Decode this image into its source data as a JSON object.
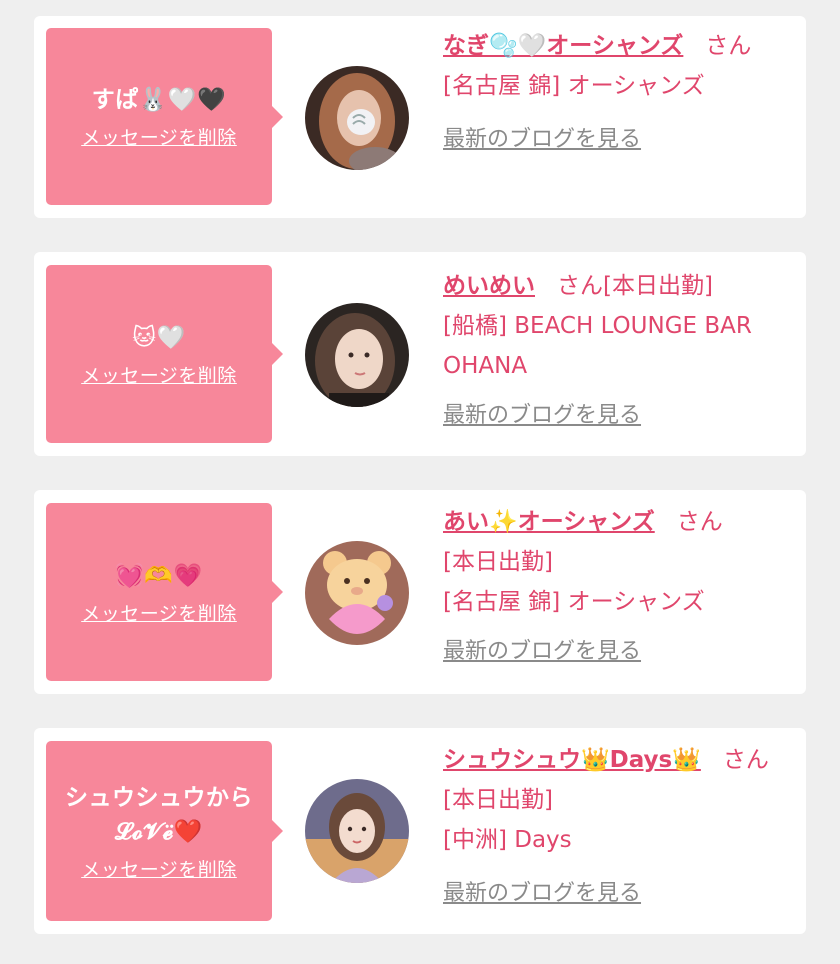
{
  "cards": [
    {
      "message": "すぱ🐰🤍🖤",
      "message_line2": "",
      "delete_label": "メッセージを削除",
      "name": "なぎ🫧🤍オーシャンズ",
      "honorific": "さん",
      "status": "",
      "shop": "[名古屋 錦] オーシャンズ",
      "blog_label": "最新のブログを見る"
    },
    {
      "message": "🐱🤍",
      "message_line2": "",
      "delete_label": "メッセージを削除",
      "name": "めいめい",
      "honorific": "さん",
      "status": "[本日出勤]",
      "shop": "[船橋] BEACH LOUNGE BAR OHANA",
      "blog_label": "最新のブログを見る"
    },
    {
      "message": "💓🫶💗",
      "message_line2": "",
      "delete_label": "メッセージを削除",
      "name": "あい✨オーシャンズ",
      "honorific": "さん",
      "status": "[本日出勤]",
      "shop": "[名古屋 錦] オーシャンズ",
      "blog_label": "最新のブログを見る"
    },
    {
      "message": "シュウシュウから",
      "message_line2": "𝓛𝓸𝓥𝓮̈❤️",
      "delete_label": "メッセージを削除",
      "name": "シュウシュウ👑Days👑",
      "honorific": "さん",
      "status": "[本日出勤]",
      "shop": "[中洲] Days",
      "blog_label": "最新のブログを見る"
    }
  ],
  "colors": {
    "bubble": "#f7879a",
    "accent": "#e0466c",
    "muted": "#8a8a8a",
    "background": "#efefef"
  }
}
